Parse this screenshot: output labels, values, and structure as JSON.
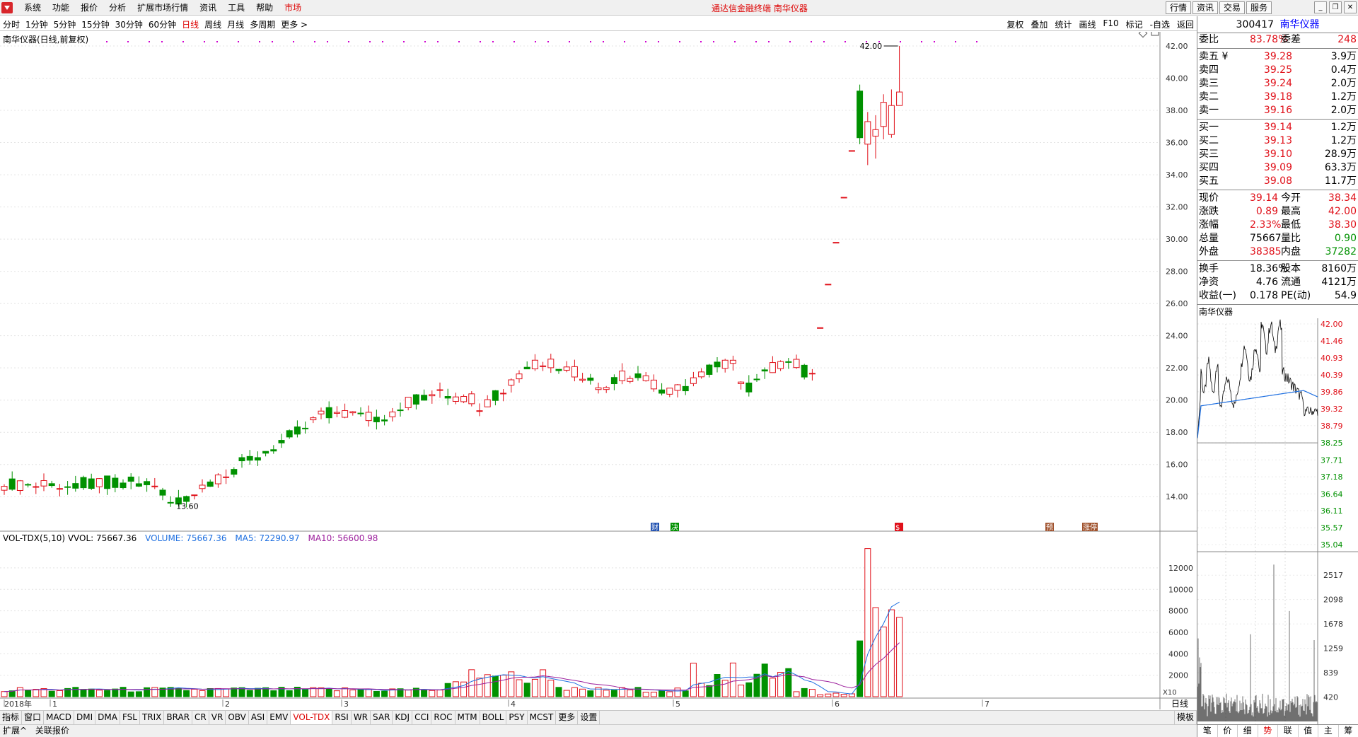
{
  "menu": {
    "items": [
      "系统",
      "功能",
      "报价",
      "分析",
      "扩展市场行情",
      "资讯",
      "工具",
      "帮助"
    ],
    "market": "市场",
    "title": "通达信金融终端  南华仪器",
    "right_buttons": [
      "行情",
      "资讯",
      "交易",
      "服务"
    ]
  },
  "periods": {
    "items": [
      "分时",
      "1分钟",
      "5分钟",
      "15分钟",
      "30分钟",
      "60分钟",
      "日线",
      "周线",
      "月线",
      "多周期",
      "更多 >"
    ],
    "active": "日线"
  },
  "tools": [
    "复权",
    "叠加",
    "统计",
    "画线",
    "F10",
    "标记",
    "-自选",
    "返回"
  ],
  "chart": {
    "title": "南华仪器(日线,前复权)",
    "price_axis": [
      "42.00",
      "40.00",
      "38.00",
      "36.00",
      "34.00",
      "32.00",
      "30.00",
      "28.00",
      "26.00",
      "24.00",
      "22.00",
      "20.00",
      "18.00",
      "16.00",
      "14.00"
    ],
    "high_label": "42.00",
    "low_label": "13.60",
    "date_labels": [
      "2018年",
      "1",
      "2",
      "3",
      "4",
      "5",
      "6",
      "7"
    ],
    "event_markers": [
      "财",
      "决",
      "$",
      "预",
      "涨停"
    ]
  },
  "volume": {
    "title": "VOL-TDX(5,10) VVOL: 75667.36",
    "volume": "VOLUME: 75667.36",
    "ma5": "MA5: 72290.97",
    "ma10": "MA10: 56600.98",
    "axis": [
      "12000",
      "10000",
      "8000",
      "6000",
      "4000",
      "2000"
    ],
    "unit": "X10"
  },
  "tabs": {
    "items": [
      "指标",
      "窗口",
      "MACD",
      "DMI",
      "DMA",
      "FSL",
      "TRIX",
      "BRAR",
      "CR",
      "VR",
      "OBV",
      "ASI",
      "EMV",
      "VOL-TDX",
      "RSI",
      "WR",
      "SAR",
      "KDJ",
      "CCI",
      "ROC",
      "MTM",
      "BOLL",
      "PSY",
      "MCST",
      "更多",
      "设置"
    ],
    "active": "VOL-TDX",
    "right": "模板"
  },
  "status": [
    "扩展^",
    "关联报价"
  ],
  "quote": {
    "code": "300417",
    "name": "南华仪器",
    "weibi_label": "委比",
    "weibi": "83.78%",
    "weicha_label": "委差",
    "weicha": "248",
    "asks": [
      {
        "label": "卖五 ¥",
        "price": "39.28",
        "vol": "3.9万"
      },
      {
        "label": "卖四",
        "price": "39.25",
        "vol": "0.4万"
      },
      {
        "label": "卖三",
        "price": "39.24",
        "vol": "2.0万"
      },
      {
        "label": "卖二",
        "price": "39.18",
        "vol": "1.2万"
      },
      {
        "label": "卖一",
        "price": "39.16",
        "vol": "2.0万"
      }
    ],
    "bids": [
      {
        "label": "买一",
        "price": "39.14",
        "vol": "1.2万"
      },
      {
        "label": "买二",
        "price": "39.13",
        "vol": "1.2万"
      },
      {
        "label": "买三",
        "price": "39.10",
        "vol": "28.9万"
      },
      {
        "label": "买四",
        "price": "39.09",
        "vol": "63.3万"
      },
      {
        "label": "买五",
        "price": "39.08",
        "vol": "11.7万"
      }
    ],
    "stats": [
      {
        "l": "现价",
        "v": "39.14",
        "vc": "red",
        "l2": "今开",
        "v2": "38.34",
        "v2c": "red"
      },
      {
        "l": "涨跌",
        "v": "0.89",
        "vc": "red",
        "l2": "最高",
        "v2": "42.00",
        "v2c": "red"
      },
      {
        "l": "涨幅",
        "v": "2.33%",
        "vc": "red",
        "l2": "最低",
        "v2": "38.30",
        "v2c": "red"
      },
      {
        "l": "总量",
        "v": "75667",
        "vc": "",
        "l2": "量比",
        "v2": "0.90",
        "v2c": "green"
      },
      {
        "l": "外盘",
        "v": "38385",
        "vc": "red",
        "l2": "内盘",
        "v2": "37282",
        "v2c": "green"
      }
    ],
    "stats2": [
      {
        "l": "换手",
        "v": "18.36%",
        "l2": "股本",
        "v2": "8160万"
      },
      {
        "l": "净资",
        "v": "4.76",
        "l2": "流通",
        "v2": "4121万"
      },
      {
        "l": "收益(一)",
        "v": "0.178",
        "l2": "PE(动)",
        "v2": "54.9"
      }
    ]
  },
  "mini": {
    "title": "南华仪器",
    "price_axis": [
      "42.00",
      "41.46",
      "40.93",
      "40.39",
      "39.86",
      "39.32",
      "38.79",
      "38.25",
      "37.71",
      "37.18",
      "36.64",
      "36.11",
      "35.57",
      "35.04"
    ],
    "vol_axis": [
      "2517",
      "2098",
      "1678",
      "1259",
      "839",
      "420"
    ]
  },
  "bottom_tabs": [
    "笔",
    "价",
    "细",
    "势",
    "联",
    "值",
    "主",
    "筹"
  ],
  "bottom_active": "势",
  "colors": {
    "up": "#e0111a",
    "down": "#009100",
    "ma5": "#1e6fe0",
    "ma10": "#9c1e9c"
  }
}
